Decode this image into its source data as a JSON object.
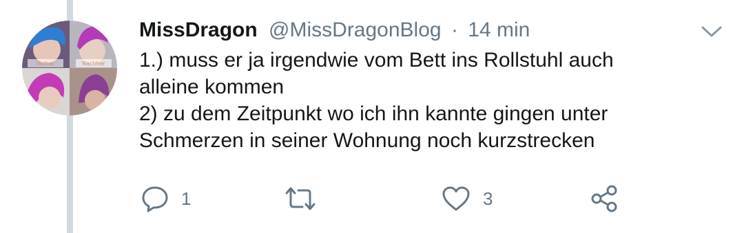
{
  "avatar": {
    "label_left": "Vorher",
    "label_right": "Nachher"
  },
  "tweet": {
    "display_name": "MissDragon",
    "handle": "@MissDragonBlog",
    "separator": "·",
    "time": "14 min",
    "lines": [
      "1.) muss er ja irgendwie vom Bett ins Rollstuhl auch",
      "alleine kommen",
      "2) zu dem Zeitpunkt wo ich ihn kannte gingen unter",
      "Schmerzen in seiner Wohnung noch kurzstrecken"
    ]
  },
  "actions": {
    "reply_count": "1",
    "retweet_count": "",
    "like_count": "3"
  },
  "icons": {
    "reply": "reply-icon",
    "retweet": "retweet-icon",
    "like": "heart-icon",
    "share": "share-icon",
    "menu": "chevron-down-icon"
  },
  "colors": {
    "text": "#14171a",
    "secondary": "#657786",
    "thread_line": "#cfd9de"
  }
}
